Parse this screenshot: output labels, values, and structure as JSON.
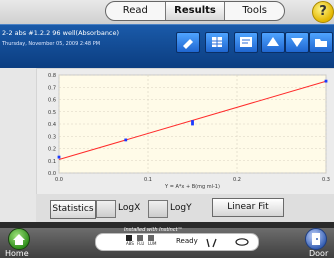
{
  "tabs": [
    {
      "label": "Read",
      "active": false
    },
    {
      "label": "Results",
      "active": true
    },
    {
      "label": "Tools",
      "active": false
    }
  ],
  "help_label": "?",
  "header": {
    "title": "2-2 abs #1.2.2 96 well(Absorbance)",
    "date": "Thursday, November 05, 2009 2:48 PM"
  },
  "toolbar": {
    "icons": [
      "edit-icon",
      "table-icon",
      "report-icon",
      "up-arrow-icon",
      "down-arrow-icon",
      "folder-icon"
    ]
  },
  "controls": {
    "statistics_label": "Statistics",
    "logx_label": "LogX",
    "logy_label": "LogY",
    "fit_label": "Linear Fit"
  },
  "bottom": {
    "home_label": "Home",
    "door_label": "Door",
    "installed_label": "Installed with Instinct™",
    "status_label": "Ready",
    "abs_label": "ABS",
    "flu_label": "FLU",
    "lum_label": "LUM"
  },
  "chart_data": {
    "type": "scatter",
    "x_label": "Y = A*x + B(mg ml-1)",
    "xlim": [
      0,
      0.3
    ],
    "ylim": [
      0,
      0.8
    ],
    "x_ticks": [
      "0.0",
      "0.1",
      "0.2",
      "0.3"
    ],
    "y_ticks": [
      "0.0",
      "0.1",
      "0.2",
      "0.3",
      "0.4",
      "0.5",
      "0.6",
      "0.7",
      "0.8"
    ],
    "points": [
      {
        "x": 0.0,
        "y": 0.13
      },
      {
        "x": 0.075,
        "y": 0.27
      },
      {
        "x": 0.15,
        "y": 0.4
      },
      {
        "x": 0.15,
        "y": 0.42
      },
      {
        "x": 0.3,
        "y": 0.75
      }
    ],
    "fit": {
      "type": "linear",
      "a": 2.13,
      "b": 0.11
    },
    "colors": {
      "point": "#1a3aff",
      "fit": "#ff2b2b"
    }
  }
}
